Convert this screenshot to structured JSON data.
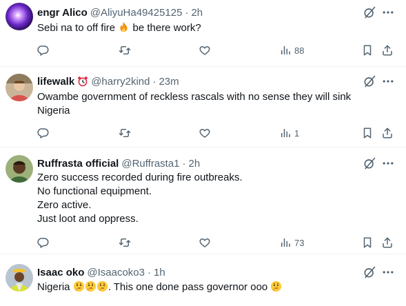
{
  "tweets": [
    {
      "name": "engr Alico",
      "handle": "@AliyuHa49425125",
      "time": "2h",
      "lines": [
        "Sebi na to off fire",
        "be there work?"
      ],
      "views": "88",
      "avatar": "purple-glow"
    },
    {
      "name": "lifewalk",
      "handle": "@harry2kind",
      "time": "23m",
      "lines": [
        "Owambe government of reckless rascals with no sense they will sink",
        "Nigeria"
      ],
      "views": "1",
      "badge": "alarm-clock-emoji",
      "avatar": "photo-man"
    },
    {
      "name": "Ruffrasta official",
      "handle": "@Ruffrasta1",
      "time": "2h",
      "lines": [
        "Zero success recorded during fire outbreaks.",
        "No functional equipment.",
        "Zero active.",
        "Just loot and oppress."
      ],
      "views": "73",
      "avatar": "photo-man-green"
    },
    {
      "name": "Isaac oko",
      "handle": "@Isaacoko3",
      "time": "1h",
      "lines": [
        ". This one done pass governor ooo"
      ],
      "first_word": "Nigeria",
      "avatar": "photo-worker"
    }
  ],
  "separator": "·",
  "colors": {
    "text": "#0f1419",
    "secondary": "#536471",
    "divider": "#eff3f4"
  },
  "icons": [
    "grok-icon",
    "more-icon",
    "reply-icon",
    "retweet-icon",
    "like-icon",
    "views-icon",
    "bookmark-icon",
    "share-icon",
    "fire-emoji",
    "thinking-emoji",
    "alarm-clock-emoji"
  ]
}
